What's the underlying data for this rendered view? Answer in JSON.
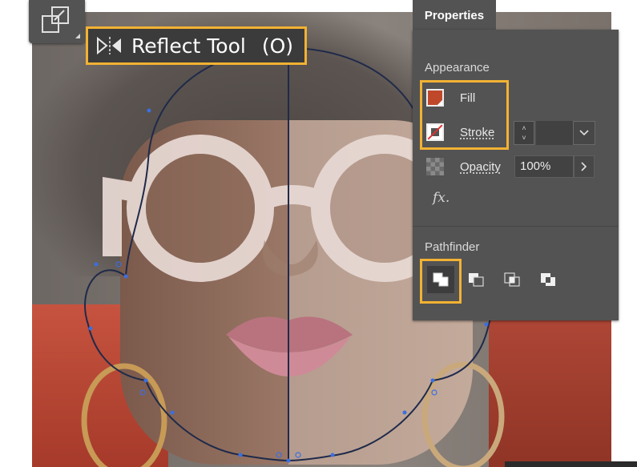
{
  "tooltip": {
    "tool_name": "Reflect Tool",
    "shortcut": "(O)"
  },
  "icons": {
    "tool_icon": "reflect-tool-icon",
    "tooltip_icon": "reflect-icon",
    "opacity_icon": "checkerboard-icon",
    "fx_icon": "fx-icon"
  },
  "panel": {
    "tab_label": "Properties",
    "appearance": {
      "title": "Appearance",
      "fill_label": "Fill",
      "stroke_label": "Stroke",
      "opacity_label": "Opacity",
      "opacity_value": "100%",
      "fx_label": "fx."
    },
    "pathfinder": {
      "title": "Pathfinder",
      "buttons": [
        "unite",
        "minus-front",
        "intersect",
        "exclude"
      ]
    }
  },
  "colors": {
    "highlight": "#f2b233",
    "fill": "#c0482a",
    "panel_bg": "#535353",
    "path_stroke": "#1f2a4a",
    "anchor": "#3b6fe0"
  }
}
